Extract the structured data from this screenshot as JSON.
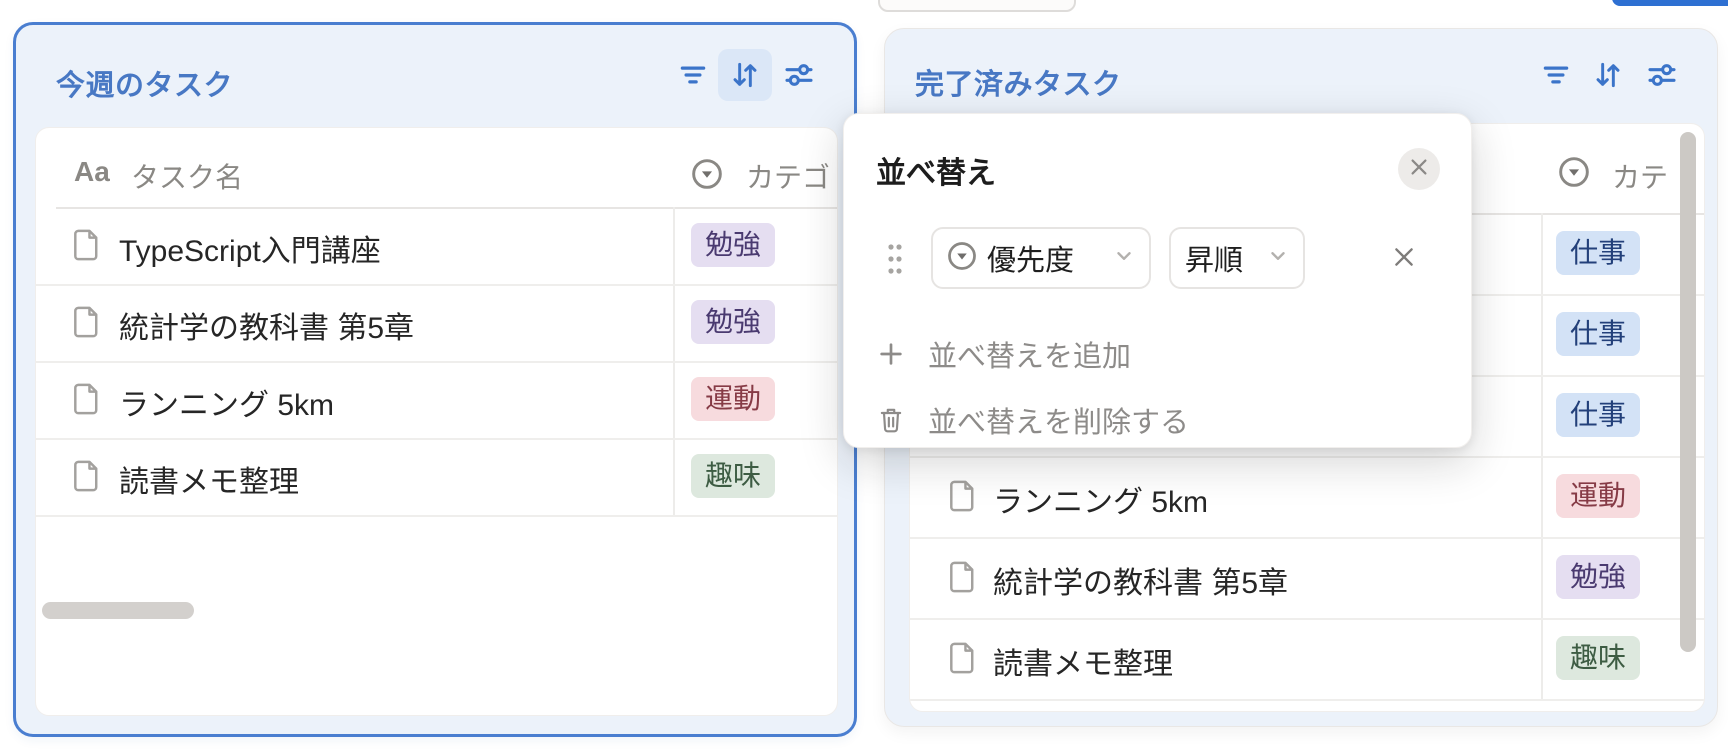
{
  "colors": {
    "accent_blue": "#2e70d2",
    "title_blue": "#4878c4",
    "icon_blue": "#3b74c9",
    "selected_card_border": "#4a7ed0",
    "header_band": "#ecf2fa",
    "badge_purple_bg": "#e5def1",
    "badge_purple_text": "#4a3a70",
    "badge_red_bg": "#f7dbde",
    "badge_red_text": "#863b46",
    "badge_green_bg": "#dde8de",
    "badge_green_text": "#3d5c43",
    "badge_blue_bg": "#d3e2f6",
    "badge_blue_text": "#23407a"
  },
  "left_panel": {
    "title": "今週のタスク",
    "toolbar": {
      "filter_icon": "filter-lines",
      "sort_icon": "sort-arrows",
      "settings_icon": "sliders",
      "active_tool": "sort"
    },
    "header": {
      "name_icon": "Aa",
      "name_label": "タスク名",
      "category_label": "カテゴ"
    },
    "rows": [
      {
        "title": "TypeScript入門講座",
        "category": "勉強",
        "color": "purple"
      },
      {
        "title": "統計学の教科書 第5章",
        "category": "勉強",
        "color": "purple"
      },
      {
        "title": "ランニング 5km",
        "category": "運動",
        "color": "red"
      },
      {
        "title": "読書メモ整理",
        "category": "趣味",
        "color": "green"
      }
    ]
  },
  "right_panel": {
    "title": "完了済みタスク",
    "toolbar": {
      "filter_icon": "filter-lines",
      "sort_icon": "sort-arrows",
      "settings_icon": "sliders",
      "active_tool": ""
    },
    "header": {
      "category_label": "カテ"
    },
    "rows": [
      {
        "title": "",
        "category": "仕事",
        "color": "blue"
      },
      {
        "title": "",
        "category": "仕事",
        "color": "blue"
      },
      {
        "title": "",
        "category": "仕事",
        "color": "blue"
      },
      {
        "title": "ランニング 5km",
        "category": "運動",
        "color": "red"
      },
      {
        "title": "統計学の教科書 第5章",
        "category": "勉強",
        "color": "purple"
      },
      {
        "title": "読書メモ整理",
        "category": "趣味",
        "color": "green"
      }
    ]
  },
  "sort_popup": {
    "title": "並べ替え",
    "rule": {
      "field": "優先度",
      "order": "昇順"
    },
    "add_label": "並べ替えを追加",
    "delete_label": "並べ替えを削除する"
  }
}
